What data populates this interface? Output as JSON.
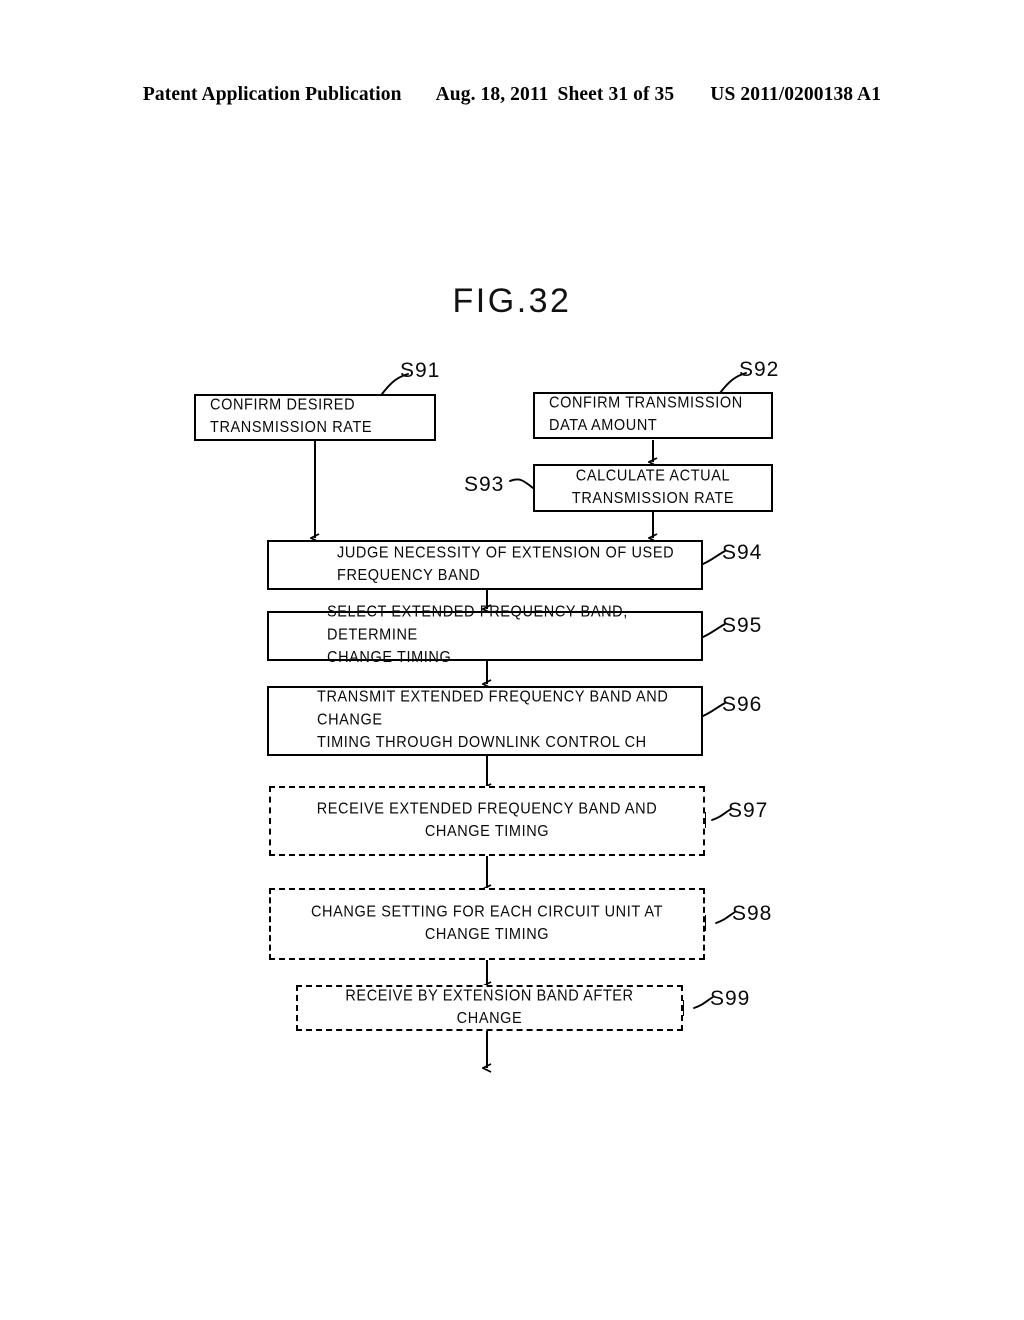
{
  "header": {
    "title": "Patent Application Publication",
    "date": "Aug. 18, 2011",
    "sheet": "Sheet 31 of 35",
    "pub_number": "US 2011/0200138 A1"
  },
  "figure": {
    "title": "FIG.32",
    "type": "flowchart",
    "steps": [
      {
        "id": "S91",
        "label": "S91",
        "text": "CONFIRM DESIRED\nTRANSMISSION RATE",
        "style": "solid",
        "label_side": "top-right"
      },
      {
        "id": "S92",
        "label": "S92",
        "text": "CONFIRM TRANSMISSION\nDATA AMOUNT",
        "style": "solid",
        "label_side": "top-right"
      },
      {
        "id": "S93",
        "label": "S93",
        "text": "CALCULATE ACTUAL\nTRANSMISSION RATE",
        "style": "solid",
        "label_side": "left"
      },
      {
        "id": "S94",
        "label": "S94",
        "text": "JUDGE NECESSITY OF EXTENSION OF  USED\nFREQUENCY BAND",
        "style": "solid",
        "label_side": "right"
      },
      {
        "id": "S95",
        "label": "S95",
        "text": "SELECT EXTENDED FREQUENCY BAND, DETERMINE\nCHANGE TIMING",
        "style": "solid",
        "label_side": "right"
      },
      {
        "id": "S96",
        "label": "S96",
        "text": "TRANSMIT EXTENDED FREQUENCY BAND AND CHANGE\nTIMING THROUGH DOWNLINK CONTROL CH",
        "style": "solid",
        "label_side": "right"
      },
      {
        "id": "S97",
        "label": "S97",
        "text": "RECEIVE EXTENDED FREQUENCY BAND AND CHANGE TIMING",
        "style": "dashed",
        "label_side": "right"
      },
      {
        "id": "S98",
        "label": "S98",
        "text": "CHANGE SETTING FOR EACH CIRCUIT UNIT AT CHANGE TIMING",
        "style": "dashed",
        "label_side": "right"
      },
      {
        "id": "S99",
        "label": "S99",
        "text": "RECEIVE BY EXTENSION BAND AFTER CHANGE",
        "style": "dashed",
        "label_side": "right"
      }
    ],
    "connections": [
      {
        "from": "S92",
        "to": "S93"
      },
      {
        "from": "S91",
        "to": "S94"
      },
      {
        "from": "S93",
        "to": "S94"
      },
      {
        "from": "S94",
        "to": "S95"
      },
      {
        "from": "S95",
        "to": "S96"
      },
      {
        "from": "S96",
        "to": "S97"
      },
      {
        "from": "S97",
        "to": "S98"
      },
      {
        "from": "S98",
        "to": "S99"
      },
      {
        "from": "S99",
        "to": "exit"
      }
    ]
  }
}
